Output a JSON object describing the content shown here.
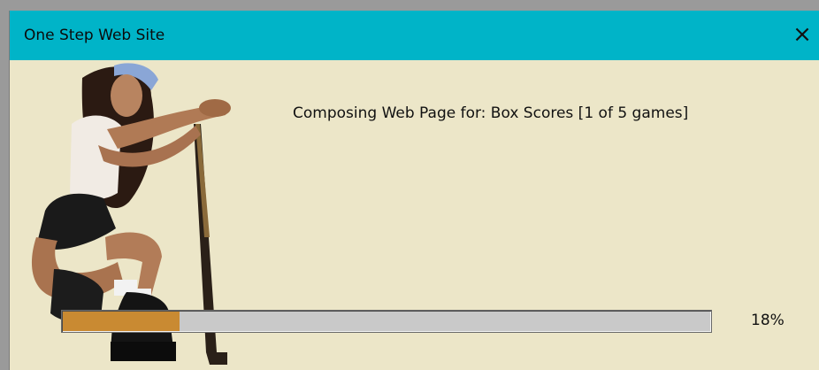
{
  "window": {
    "title": "One Step Web Site",
    "close_glyph": "×"
  },
  "status": {
    "message": "Composing Web Page for: Box Scores [1 of 5 games]"
  },
  "progress": {
    "percent_label": "18%",
    "fraction": 0.18,
    "fill_color": "#c98a32",
    "track_color": "#c9c9c9"
  },
  "colors": {
    "titlebar": "#00b4c8",
    "background": "#ece6c8"
  },
  "icons": {
    "close": "close-icon"
  }
}
